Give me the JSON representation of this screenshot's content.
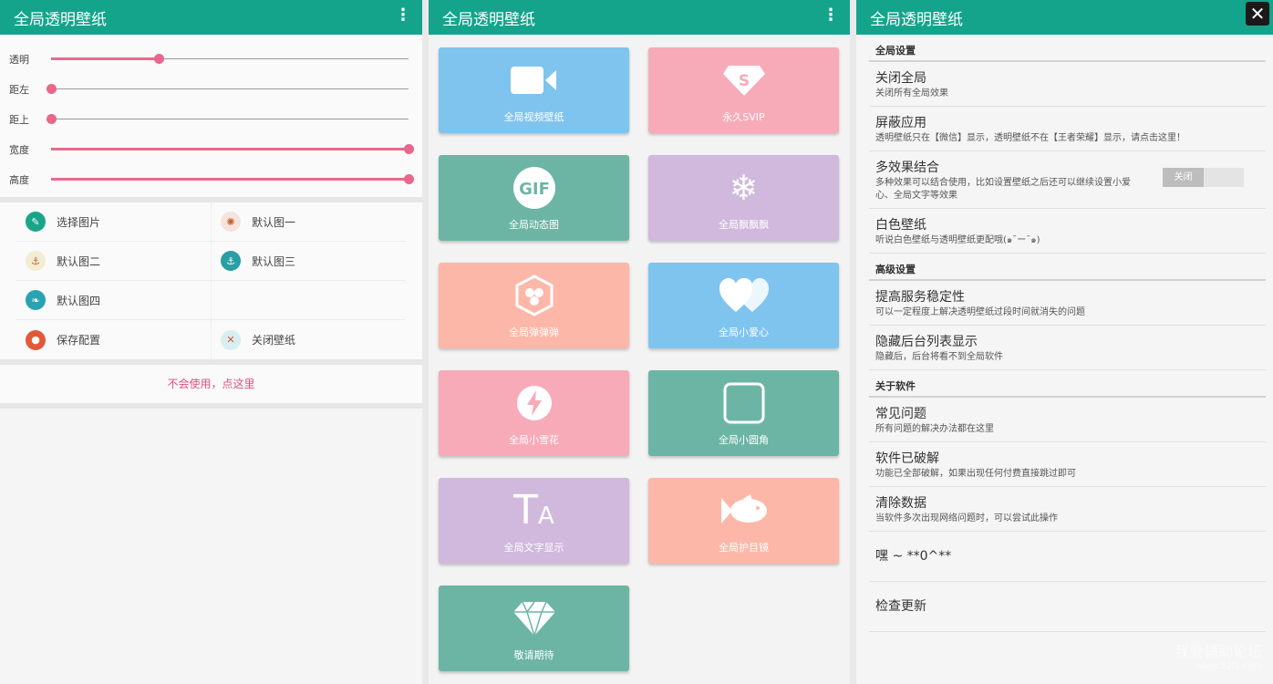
{
  "p1": {
    "title": "全局透明壁纸",
    "menu_glyph": "⋮",
    "sliders": [
      {
        "label": "透明",
        "value": 0.3
      },
      {
        "label": "距左",
        "value": 0.0
      },
      {
        "label": "距上",
        "value": 0.0
      },
      {
        "label": "宽度",
        "value": 1.0
      },
      {
        "label": "高度",
        "value": 1.0
      }
    ],
    "options": [
      {
        "label": "选择图片",
        "icon": "pen-icon",
        "color": "#1aa58a"
      },
      {
        "label": "默认图一",
        "icon": "crab-icon",
        "color": "#f6e3dc"
      },
      {
        "label": "默认图二",
        "icon": "anchor-icon",
        "color": "#f2ecd3"
      },
      {
        "label": "默认图三",
        "icon": "anchor-icon",
        "color": "#2a9ea4"
      },
      {
        "label": "默认图四",
        "icon": "leaf-icon",
        "color": "#2aa2b2"
      },
      {
        "label": "",
        "icon": "",
        "color": ""
      },
      {
        "label": "保存配置",
        "icon": "save-icon",
        "color": "#e05a3a"
      },
      {
        "label": "关闭壁纸",
        "icon": "close-icon",
        "color": "#d9eef0"
      }
    ],
    "help_link": "不会使用，点这里"
  },
  "p2": {
    "title": "全局透明壁纸",
    "menu_glyph": "⋮",
    "tiles": [
      {
        "label": "全局视频壁纸",
        "icon": "video-camera-icon",
        "color": "#7fc4ef"
      },
      {
        "label": "永久SVIP",
        "icon": "superman-s-icon",
        "color": "#f7abb9"
      },
      {
        "label": "全局动态图",
        "icon": "gif-icon",
        "color": "#6cb5a5",
        "glyph": "GIF"
      },
      {
        "label": "全局飘飘飘",
        "icon": "snowflake-icon",
        "color": "#d0b9dc",
        "glyph": "❄"
      },
      {
        "label": "全局弹弹弹",
        "icon": "bubbles-hexagon-icon",
        "color": "#fdb7a8"
      },
      {
        "label": "全局小爱心",
        "icon": "hearts-icon",
        "color": "#7fc4ef"
      },
      {
        "label": "全局小雪花",
        "icon": "lightning-icon",
        "color": "#f7abb9",
        "glyph": "⚡"
      },
      {
        "label": "全局小圆角",
        "icon": "rounded-square-icon",
        "color": "#6cb5a5"
      },
      {
        "label": "全局文字显示",
        "icon": "text-icon",
        "color": "#d0b9dc",
        "glyph": "T",
        "glyph2": "A"
      },
      {
        "label": "全局护目镜",
        "icon": "fish-icon",
        "color": "#fdb7a8"
      },
      {
        "label": "敬请期待",
        "icon": "diamond-icon",
        "color": "#6cb5a5"
      }
    ]
  },
  "p3": {
    "title": "全局透明壁纸",
    "close_glyph": "✕",
    "sections": [
      {
        "header": "全局设置",
        "items": [
          {
            "title": "关闭全局",
            "sub": "关闭所有全局效果"
          },
          {
            "title": "屏蔽应用",
            "sub": "透明壁纸只在【微信】显示，透明壁纸不在【王者荣耀】显示，请点击这里！"
          },
          {
            "title": "多效果结合",
            "sub": "多种效果可以结合使用，比如设置壁纸之后还可以继续设置小爱心、全局文字等效果",
            "toggle": "关闭"
          },
          {
            "title": "白色壁纸",
            "sub": "听说白色壁纸与透明壁纸更配哦(๑¯ー¯๑)"
          }
        ]
      },
      {
        "header": "高级设置",
        "items": [
          {
            "title": "提高服务稳定性",
            "sub": "可以一定程度上解决透明壁纸过段时间就消失的问题"
          },
          {
            "title": "隐藏后台列表显示",
            "sub": "隐藏后，后台将看不到全局软件"
          }
        ]
      },
      {
        "header": "关于软件",
        "items": [
          {
            "title": "常见问题",
            "sub": "所有问题的解决办法都在这里"
          },
          {
            "title": "软件已破解",
            "sub": "功能已全部破解，如果出现任何付费直接跳过即可"
          },
          {
            "title": "清除数据",
            "sub": "当软件多次出现网络问题时，可以尝试此操作"
          },
          {
            "title": "嘿 ~ **0^**",
            "sub": ""
          },
          {
            "title": "检查更新",
            "sub": ""
          }
        ]
      }
    ],
    "watermark": "我爱辅助论坛",
    "watermark_url": "www.52fz.com"
  }
}
